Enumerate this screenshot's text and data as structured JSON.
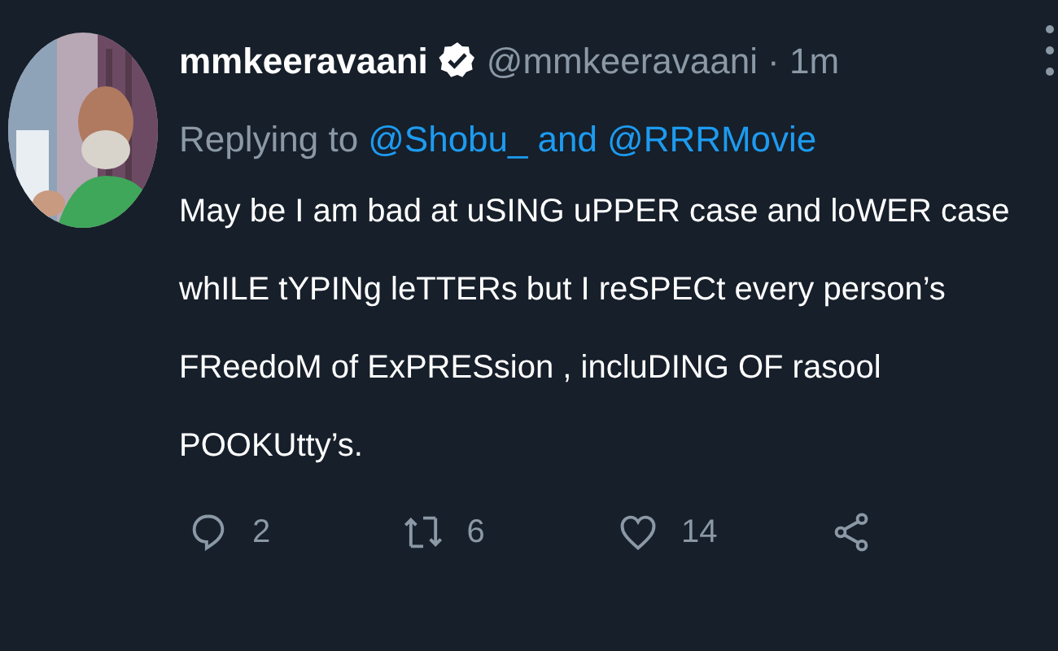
{
  "tweet": {
    "display_name": "mmkeeravaani",
    "verified": true,
    "handle": "@mmkeeravaani",
    "time": "· 1m",
    "replying_to": {
      "prefix": "Replying to",
      "mentions": [
        "@Shobu_",
        "@RRRMovie"
      ],
      "joiner": "and"
    },
    "text": "May be I am bad at uSING uPPER case and loWER case\nwhILE tYPINg leTTERs but I reSPECt every person’s\nFReedoM of ExPRESsion , incluDING OF rasool\nPOOKUtty’s.",
    "actions": [
      {
        "kind": "reply",
        "count": "2"
      },
      {
        "kind": "retweet",
        "count": "6"
      },
      {
        "kind": "like",
        "count": "14"
      },
      {
        "kind": "share"
      }
    ]
  }
}
